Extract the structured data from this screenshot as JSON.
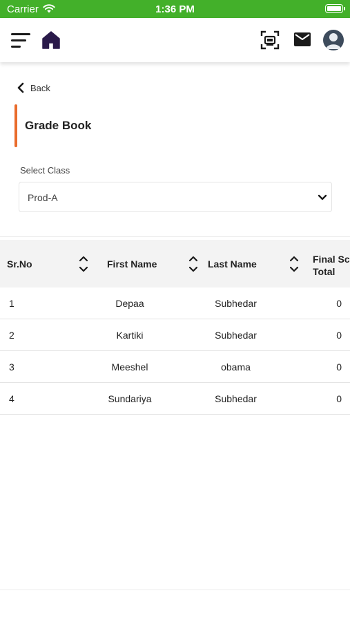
{
  "status_bar": {
    "carrier": "Carrier",
    "time": "1:36 PM"
  },
  "header": {
    "icons": [
      "menu-icon",
      "home-icon",
      "scan-icon",
      "mail-icon",
      "avatar"
    ],
    "colors": {
      "home_icon": "#2a1a4a",
      "accent_orange": "#e96b2b",
      "status_green": "#43b02a"
    }
  },
  "nav": {
    "back_label": "Back"
  },
  "page": {
    "title": "Grade Book"
  },
  "class_select": {
    "label": "Select Class",
    "value": "Prod-A"
  },
  "table": {
    "headers": {
      "sr_no": "Sr.No",
      "first_name": "First Name",
      "last_name": "Last Name",
      "final_score_line1": "Final Sc",
      "final_score_line2": "Total"
    },
    "rows": [
      {
        "sr_no": "1",
        "first_name": "Depaa",
        "last_name": "Subhedar",
        "final": "0"
      },
      {
        "sr_no": "2",
        "first_name": "Kartiki",
        "last_name": "Subhedar",
        "final": "0"
      },
      {
        "sr_no": "3",
        "first_name": "Meeshel",
        "last_name": "obama",
        "final": "0"
      },
      {
        "sr_no": "4",
        "first_name": "Sundariya",
        "last_name": "Subhedar",
        "final": "0"
      }
    ]
  }
}
